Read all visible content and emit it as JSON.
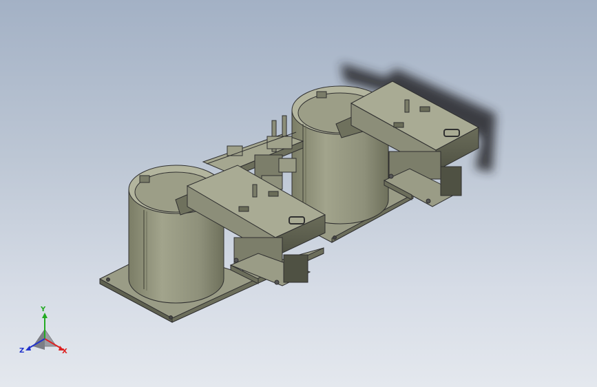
{
  "view": {
    "background_top": "#a3b1c5",
    "background_bottom": "#e4e8ee"
  },
  "model": {
    "body_color": "#8a8c74",
    "shadow_color": "#2a2c30",
    "edge_color": "#2f2f2f"
  },
  "triad": {
    "y_label": "Y",
    "z_label": "Z",
    "x_label": "X",
    "y_color": "#22aa22",
    "x_color": "#dd2222",
    "z_color": "#2233cc"
  }
}
